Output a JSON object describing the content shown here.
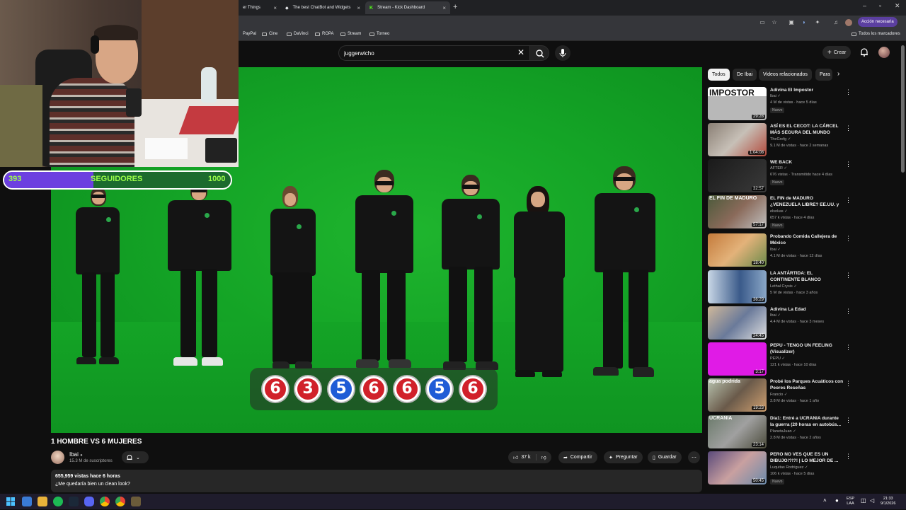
{
  "browser": {
    "tabs": [
      {
        "label": "er Things"
      },
      {
        "label": "The best ChatBot and Widgets"
      },
      {
        "label": "Stream - Kick Dashboard"
      }
    ],
    "action_button": "Acción necesaria",
    "bookmarks": [
      "PayPal",
      "Cine",
      "DaVinci",
      "ROPA",
      "Stream",
      "Torneo"
    ],
    "all_bookmarks": "Todos los marcadores"
  },
  "youtube": {
    "search_value": "juggerwicho",
    "create_label": "Crear",
    "video": {
      "title": "1 HOMBRE VS 6 MUJERES",
      "channel": "Ibai",
      "subscribers": "15.3 M de suscriptores",
      "likes": "37 k",
      "share": "Compartir",
      "ask": "Preguntar",
      "save": "Guardar",
      "views_time": "655,959 vistas  hace 6 horas",
      "description": "¿Me quedaría bien un clean look?",
      "numbers": [
        {
          "value": "6",
          "color": "#d1202a"
        },
        {
          "value": "3",
          "color": "#d1202a"
        },
        {
          "value": "5",
          "color": "#1f5cd6"
        },
        {
          "value": "6",
          "color": "#d1202a"
        },
        {
          "value": "6",
          "color": "#d1202a"
        },
        {
          "value": "5",
          "color": "#1f5cd6"
        },
        {
          "value": "6",
          "color": "#d1202a"
        }
      ]
    },
    "chips": [
      "Todos",
      "De Ibai",
      "Videos relacionados",
      "Para"
    ],
    "recommendations": [
      {
        "title": "Adivina El Impostor",
        "channel": "Ibai",
        "meta": "4 M de vistas · hace 5 días",
        "badge": "Nuevo",
        "duration": "29:28",
        "thumb_text": "IMPOSTOR"
      },
      {
        "title": "ASÍ ES EL CECOT: LA CÁRCEL MÁS SEGURA DEL MUNDO",
        "channel": "TheGrefg",
        "meta": "9.1 M de vistas · hace 2 semanas",
        "badge": "",
        "duration": "1:04:08",
        "thumb_text": ""
      },
      {
        "title": "WE BACK",
        "channel": "AFTER",
        "meta": "676 vistas · Transmitido hace 4 días",
        "badge": "Nuevo",
        "duration": "32:57",
        "thumb_text": ""
      },
      {
        "title": "EL FIN de MADURO ¿VENEZUELA LIBRE? EE.UU. y ...",
        "channel": "elsokas",
        "meta": "657 k vistas · hace 4 días",
        "badge": "Nuevo",
        "duration": "57:17",
        "thumb_text": "EL FIN DE MADURO"
      },
      {
        "title": "Probando Comida Callejera de México",
        "channel": "Ibai",
        "meta": "4.1 M de vistas · hace 12 días",
        "badge": "",
        "duration": "18:40",
        "thumb_text": ""
      },
      {
        "title": "LA ANTÁRTIDA: EL CONTINENTE BLANCO",
        "channel": "Lethal Crysis",
        "meta": "5 M de vistas · hace 3 años",
        "badge": "",
        "duration": "36:29",
        "thumb_text": ""
      },
      {
        "title": "Adivina La Edad",
        "channel": "Ibai",
        "meta": "4.4 M de vistas · hace 3 meses",
        "badge": "",
        "duration": "24:45",
        "thumb_text": ""
      },
      {
        "title": "PEPU - TENGO UN FEELING (Visualizer)",
        "channel": "PEPU",
        "meta": "121 k vistas · hace 10 días",
        "badge": "",
        "duration": "3:17",
        "thumb_text": ""
      },
      {
        "title": "Probé los Parques Acuáticos con Peores Reseñas",
        "channel": "Francio",
        "meta": "3.8 M de vistas · hace 1 año",
        "badge": "",
        "duration": "19:23",
        "thumb_text": "agua podrida"
      },
      {
        "title": "Día1: Entré a UCRANIA durante la guerra (20 horas en autobús...",
        "channel": "PlanetaJuan",
        "meta": "2.8 M de vistas · hace 2 años",
        "badge": "",
        "duration": "23:14",
        "thumb_text": "UCRANIA"
      },
      {
        "title": "PERO NO VES QUE ES UN DIBUJO!?!?! | LO MEJOR DE ...",
        "channel": "Luquitas Rodriguez",
        "meta": "106 k vistas · hace 5 días",
        "badge": "Nuevo",
        "duration": "50:45",
        "thumb_text": ""
      }
    ]
  },
  "overlay": {
    "followers_current": "393",
    "followers_label": "SEGUIDORES",
    "followers_goal": "1000",
    "followers_progress": 0.393
  },
  "taskbar": {
    "lang_top": "ESP",
    "lang_bottom": "LAA",
    "time": "21:33",
    "date": "9/1/2026"
  },
  "colors": {
    "green_screen": "#14a426",
    "followers_fill": "#6c3fe0",
    "followers_text": "#9cff4a",
    "accent_purple": "#5b3fa0"
  }
}
